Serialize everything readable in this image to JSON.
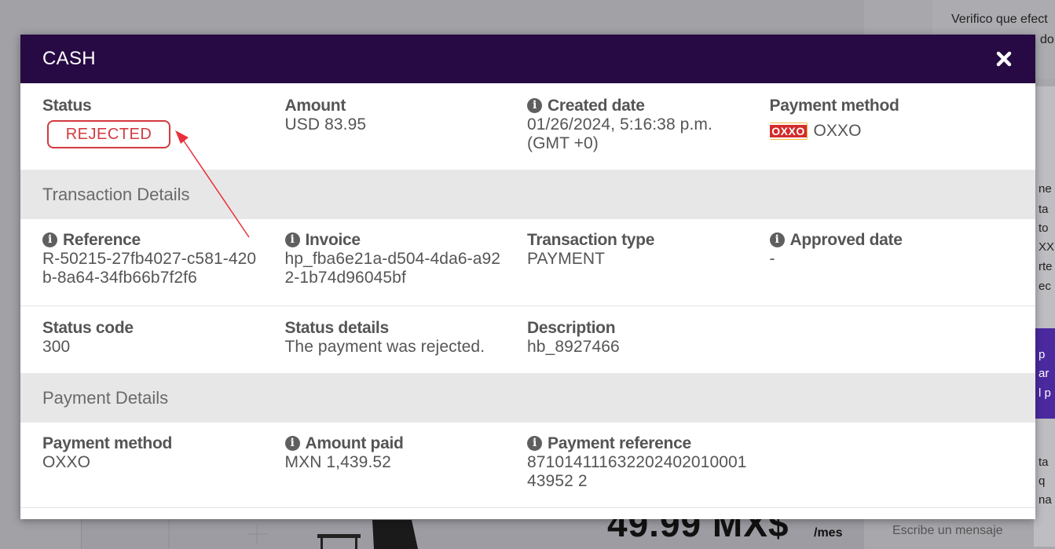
{
  "background": {
    "chat_text_1": "Verifico que efect",
    "chat_text_2": "do",
    "price": "49.99 MX$",
    "per_month": "/mes",
    "chat_input_placeholder": "Escribe un mensaje",
    "strip_texts": [
      "ne",
      "ta",
      "to",
      "XX",
      "rte",
      "ec",
      "p",
      "ar",
      "l p",
      "ta",
      "q",
      "na"
    ]
  },
  "modal": {
    "title": "CASH",
    "close_icon": "close-icon",
    "summary": {
      "status_label": "Status",
      "status_value": "REJECTED",
      "amount_label": "Amount",
      "amount_value": "USD 83.95",
      "created_label": "Created date",
      "created_value": "01/26/2024, 5:16:38 p.m. (GMT +0)",
      "payment_method_label": "Payment method",
      "payment_method_logo": "OXXO",
      "payment_method_value": "OXXO"
    },
    "transaction_details": {
      "heading": "Transaction Details",
      "reference_label": "Reference",
      "reference_value": "R-50215-27fb4027-c581-420b-8a64-34fb66b7f2f6",
      "invoice_label": "Invoice",
      "invoice_value": "hp_fba6e21a-d504-4da6-a922-1b74d96045bf",
      "transaction_type_label": "Transaction type",
      "transaction_type_value": "PAYMENT",
      "approved_date_label": "Approved date",
      "approved_date_value": "-",
      "status_code_label": "Status code",
      "status_code_value": "300",
      "status_details_label": "Status details",
      "status_details_value": "The payment was rejected.",
      "description_label": "Description",
      "description_value": "hb_8927466"
    },
    "payment_details": {
      "heading": "Payment Details",
      "payment_method_label": "Payment method",
      "payment_method_value": "OXXO",
      "amount_paid_label": "Amount paid",
      "amount_paid_value": "MXN 1,439.52",
      "payment_reference_label": "Payment reference",
      "payment_reference_value": "87101411163220240201000143952 2"
    }
  },
  "colors": {
    "header": "#270a43",
    "rejected": "#d33a3f",
    "section_bg": "#e7e7e7",
    "annotation_arrow": "#e8303a"
  }
}
